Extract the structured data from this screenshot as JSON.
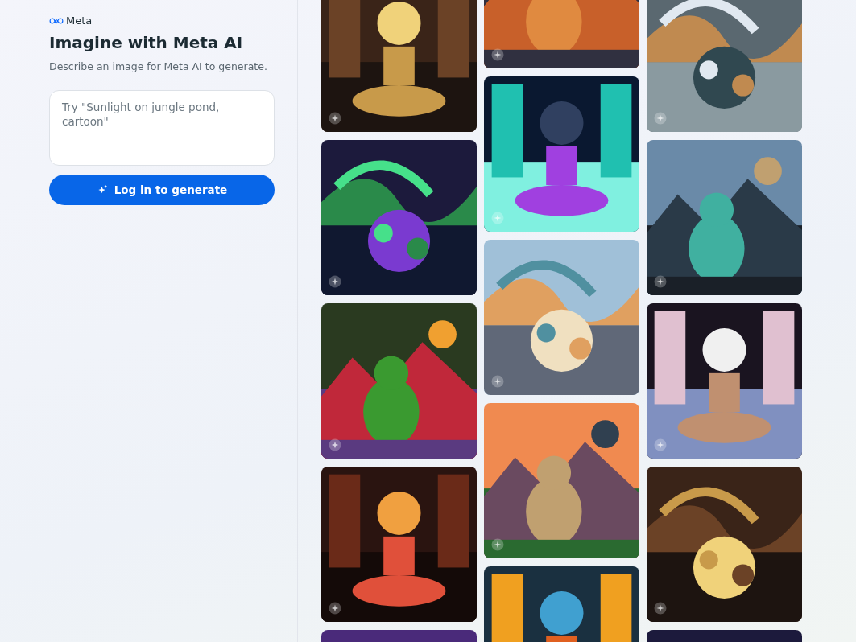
{
  "brand": {
    "name": "Meta"
  },
  "title": "Imagine with Meta AI",
  "subtitle": "Describe an image for Meta AI to generate.",
  "prompt": {
    "placeholder": "Try \"Sunlight on jungle pond, cartoon\""
  },
  "login_button": {
    "label": "Log in to generate"
  }
}
